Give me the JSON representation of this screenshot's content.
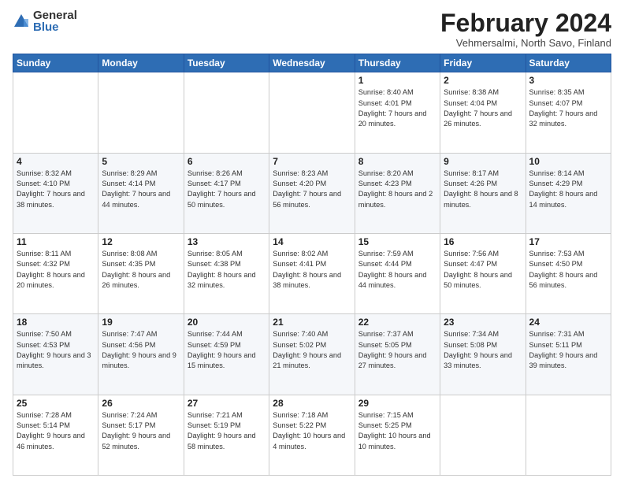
{
  "logo": {
    "general": "General",
    "blue": "Blue"
  },
  "title": "February 2024",
  "subtitle": "Vehmersalmi, North Savo, Finland",
  "days_of_week": [
    "Sunday",
    "Monday",
    "Tuesday",
    "Wednesday",
    "Thursday",
    "Friday",
    "Saturday"
  ],
  "weeks": [
    [
      {
        "day": "",
        "info": ""
      },
      {
        "day": "",
        "info": ""
      },
      {
        "day": "",
        "info": ""
      },
      {
        "day": "",
        "info": ""
      },
      {
        "day": "1",
        "info": "Sunrise: 8:40 AM\nSunset: 4:01 PM\nDaylight: 7 hours\nand 20 minutes."
      },
      {
        "day": "2",
        "info": "Sunrise: 8:38 AM\nSunset: 4:04 PM\nDaylight: 7 hours\nand 26 minutes."
      },
      {
        "day": "3",
        "info": "Sunrise: 8:35 AM\nSunset: 4:07 PM\nDaylight: 7 hours\nand 32 minutes."
      }
    ],
    [
      {
        "day": "4",
        "info": "Sunrise: 8:32 AM\nSunset: 4:10 PM\nDaylight: 7 hours\nand 38 minutes."
      },
      {
        "day": "5",
        "info": "Sunrise: 8:29 AM\nSunset: 4:14 PM\nDaylight: 7 hours\nand 44 minutes."
      },
      {
        "day": "6",
        "info": "Sunrise: 8:26 AM\nSunset: 4:17 PM\nDaylight: 7 hours\nand 50 minutes."
      },
      {
        "day": "7",
        "info": "Sunrise: 8:23 AM\nSunset: 4:20 PM\nDaylight: 7 hours\nand 56 minutes."
      },
      {
        "day": "8",
        "info": "Sunrise: 8:20 AM\nSunset: 4:23 PM\nDaylight: 8 hours\nand 2 minutes."
      },
      {
        "day": "9",
        "info": "Sunrise: 8:17 AM\nSunset: 4:26 PM\nDaylight: 8 hours\nand 8 minutes."
      },
      {
        "day": "10",
        "info": "Sunrise: 8:14 AM\nSunset: 4:29 PM\nDaylight: 8 hours\nand 14 minutes."
      }
    ],
    [
      {
        "day": "11",
        "info": "Sunrise: 8:11 AM\nSunset: 4:32 PM\nDaylight: 8 hours\nand 20 minutes."
      },
      {
        "day": "12",
        "info": "Sunrise: 8:08 AM\nSunset: 4:35 PM\nDaylight: 8 hours\nand 26 minutes."
      },
      {
        "day": "13",
        "info": "Sunrise: 8:05 AM\nSunset: 4:38 PM\nDaylight: 8 hours\nand 32 minutes."
      },
      {
        "day": "14",
        "info": "Sunrise: 8:02 AM\nSunset: 4:41 PM\nDaylight: 8 hours\nand 38 minutes."
      },
      {
        "day": "15",
        "info": "Sunrise: 7:59 AM\nSunset: 4:44 PM\nDaylight: 8 hours\nand 44 minutes."
      },
      {
        "day": "16",
        "info": "Sunrise: 7:56 AM\nSunset: 4:47 PM\nDaylight: 8 hours\nand 50 minutes."
      },
      {
        "day": "17",
        "info": "Sunrise: 7:53 AM\nSunset: 4:50 PM\nDaylight: 8 hours\nand 56 minutes."
      }
    ],
    [
      {
        "day": "18",
        "info": "Sunrise: 7:50 AM\nSunset: 4:53 PM\nDaylight: 9 hours\nand 3 minutes."
      },
      {
        "day": "19",
        "info": "Sunrise: 7:47 AM\nSunset: 4:56 PM\nDaylight: 9 hours\nand 9 minutes."
      },
      {
        "day": "20",
        "info": "Sunrise: 7:44 AM\nSunset: 4:59 PM\nDaylight: 9 hours\nand 15 minutes."
      },
      {
        "day": "21",
        "info": "Sunrise: 7:40 AM\nSunset: 5:02 PM\nDaylight: 9 hours\nand 21 minutes."
      },
      {
        "day": "22",
        "info": "Sunrise: 7:37 AM\nSunset: 5:05 PM\nDaylight: 9 hours\nand 27 minutes."
      },
      {
        "day": "23",
        "info": "Sunrise: 7:34 AM\nSunset: 5:08 PM\nDaylight: 9 hours\nand 33 minutes."
      },
      {
        "day": "24",
        "info": "Sunrise: 7:31 AM\nSunset: 5:11 PM\nDaylight: 9 hours\nand 39 minutes."
      }
    ],
    [
      {
        "day": "25",
        "info": "Sunrise: 7:28 AM\nSunset: 5:14 PM\nDaylight: 9 hours\nand 46 minutes."
      },
      {
        "day": "26",
        "info": "Sunrise: 7:24 AM\nSunset: 5:17 PM\nDaylight: 9 hours\nand 52 minutes."
      },
      {
        "day": "27",
        "info": "Sunrise: 7:21 AM\nSunset: 5:19 PM\nDaylight: 9 hours\nand 58 minutes."
      },
      {
        "day": "28",
        "info": "Sunrise: 7:18 AM\nSunset: 5:22 PM\nDaylight: 10 hours\nand 4 minutes."
      },
      {
        "day": "29",
        "info": "Sunrise: 7:15 AM\nSunset: 5:25 PM\nDaylight: 10 hours\nand 10 minutes."
      },
      {
        "day": "",
        "info": ""
      },
      {
        "day": "",
        "info": ""
      }
    ]
  ]
}
